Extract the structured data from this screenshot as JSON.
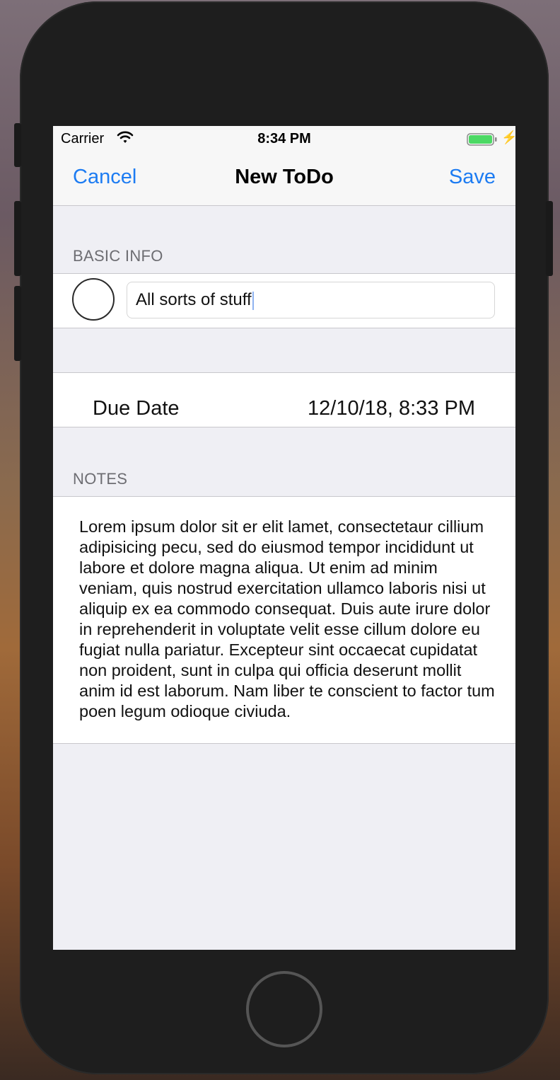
{
  "status_bar": {
    "carrier": "Carrier",
    "time": "8:34 PM"
  },
  "nav": {
    "cancel_label": "Cancel",
    "title": "New ToDo",
    "save_label": "Save"
  },
  "basic_info": {
    "header": "BASIC INFO",
    "title_value": "All sorts of stuff",
    "completed": false
  },
  "due_date": {
    "label": "Due Date",
    "value": "12/10/18, 8:33 PM"
  },
  "notes": {
    "header": "NOTES",
    "text": "Lorem ipsum dolor sit er elit lamet, consectetaur cillium adipisicing pecu, sed do eiusmod tempor incididunt ut labore et dolore magna aliqua. Ut enim ad minim veniam, quis nostrud exercitation ullamco laboris nisi ut aliquip ex ea commodo consequat. Duis aute irure dolor in reprehenderit in voluptate velit esse cillum dolore eu fugiat nulla pariatur. Excepteur sint occaecat cupidatat non proident, sunt in culpa qui officia deserunt mollit anim id est laborum. Nam liber te conscient to factor tum poen legum odioque civiuda."
  },
  "colors": {
    "accent": "#1d7cf2",
    "battery": "#4cd964",
    "grouped_background": "#efeff4"
  }
}
